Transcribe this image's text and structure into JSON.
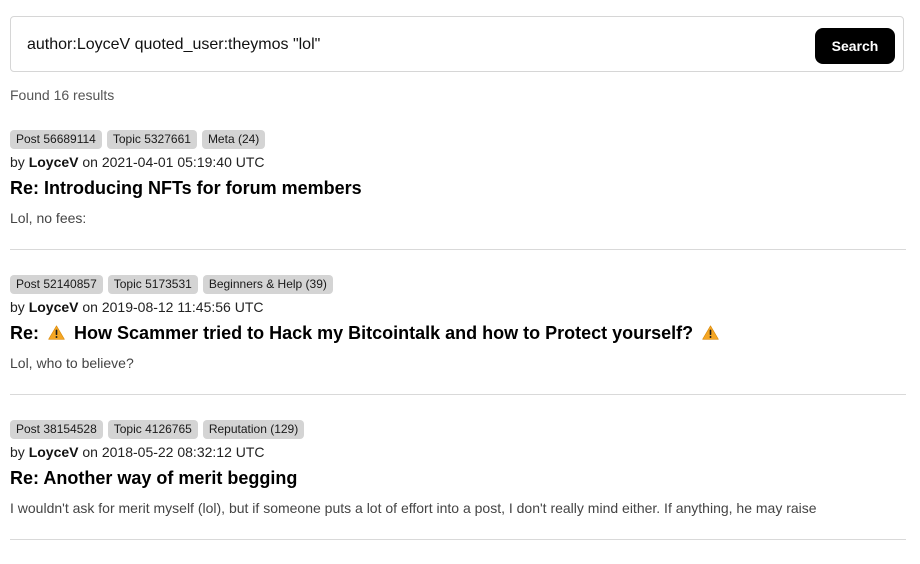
{
  "search": {
    "query": "author:LoyceV quoted_user:theymos \"lol\"",
    "button_label": "Search"
  },
  "results_count": "Found 16 results",
  "results": [
    {
      "post": "Post 56689114",
      "topic": "Topic 5327661",
      "board": "Meta (24)",
      "by": "by",
      "author": "LoyceV",
      "on": "on",
      "date": "2021-04-01 05:19:40 UTC",
      "title": "Re: Introducing NFTs for forum members",
      "excerpt": "Lol, no fees:"
    },
    {
      "post": "Post 52140857",
      "topic": "Topic 5173531",
      "board": "Beginners & Help (39)",
      "by": "by",
      "author": "LoyceV",
      "on": "on",
      "date": "2019-08-12 11:45:56 UTC",
      "title_prefix": "Re:",
      "title_main": "How Scammer tried to Hack my Bitcointalk and how to Protect yourself?",
      "title_icon": "warning-icon",
      "excerpt": "Lol, who to believe?"
    },
    {
      "post": "Post 38154528",
      "topic": "Topic 4126765",
      "board": "Reputation (129)",
      "by": "by",
      "author": "LoyceV",
      "on": "on",
      "date": "2018-05-22 08:32:12 UTC",
      "title": "Re: Another way of merit begging",
      "excerpt": "I wouldn't ask for merit myself (lol), but if someone puts a lot of effort into a post, I don't really mind either. If anything, he may raise"
    }
  ],
  "colors": {
    "badge_bg": "#d4d4d4",
    "button_bg": "#000000",
    "warning": "#f5a623"
  }
}
